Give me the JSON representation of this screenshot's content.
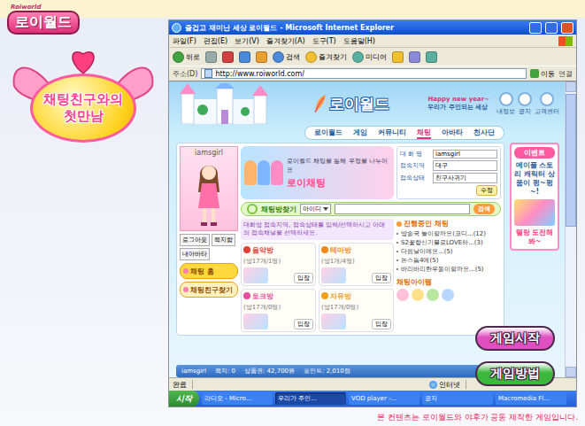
{
  "logo": {
    "small": "Roiworld",
    "title": "로이월드"
  },
  "badge": {
    "title": "채팅친구와의 첫만남"
  },
  "browser": {
    "title": "즐겁고 재미난 세상 로이월드 - Microsoft Internet Explorer",
    "menu": [
      "파일(F)",
      "편집(E)",
      "보기(V)",
      "즐겨찾기(A)",
      "도구(T)",
      "도움말(H)"
    ],
    "toolbar": [
      "뒤로",
      "검색",
      "즐겨찾기",
      "미디어"
    ],
    "address_label": "주소(D)",
    "address": "http://www.roiworld.com/",
    "go": "이동",
    "links": "연결",
    "status": "완료",
    "zone": "인터넷"
  },
  "site": {
    "logo": "로이월드",
    "greeting": "Happy new year~",
    "slogan": "우리가 주인되는 세상",
    "top_icons": [
      "내정보",
      "공지",
      "고객센터"
    ],
    "nav": [
      {
        "label": "로이월드",
        "selected": false
      },
      {
        "label": "게임",
        "selected": false
      },
      {
        "label": "커뮤니티",
        "selected": false
      },
      {
        "label": "채팅",
        "selected": true
      },
      {
        "label": "아바타",
        "selected": false
      },
      {
        "label": "천사단",
        "selected": false
      }
    ],
    "profile": {
      "name": "iamsgirl",
      "buttons": [
        "로그아웃",
        "쪽지함",
        "내아바타"
      ]
    },
    "side_menu": [
      {
        "label": "채팅 홈",
        "selected": true
      },
      {
        "label": "채팅친구찾기",
        "selected": false
      }
    ],
    "banner": {
      "text": "로이월드 채팅을 통해 우정을 나누어요",
      "title": "로이채팅"
    },
    "info": {
      "rows": [
        {
          "label": "대 화 명",
          "value": "iamsgirl"
        },
        {
          "label": "접속지역",
          "value": "대구"
        },
        {
          "label": "접속상태",
          "value": "친구사귀기"
        }
      ],
      "button": "수정"
    },
    "search": {
      "label": "채팅방찾기",
      "field": "아이디",
      "button": "검색"
    },
    "notice": "대화방 접속지역, 접속상태를 입력/선택하시고 아래의 접속채널을 선택하세요.",
    "channels": [
      {
        "name": "음악방",
        "count": "(방17개/1명)",
        "button": "입장",
        "color": "#e0403a"
      },
      {
        "name": "테마방",
        "count": "(방1개/4명)",
        "button": "입장",
        "color": "#ef8a1a"
      },
      {
        "name": "토크방",
        "count": "(방17개/0명)",
        "button": "입장",
        "color": "#e04fa0"
      },
      {
        "name": "자유방",
        "count": "(방17개/0명)",
        "button": "입장",
        "color": "#f0a020"
      }
    ],
    "live": {
      "title": "진행중인 채팅",
      "items": [
        "방송국 놀이할까요(코디...(12)",
        "S2꽃향신기블로LOVE하...(3)",
        "다음날이에요...(5)",
        "논스톱4에(5)",
        "바리바리한우동이할까요...(5)"
      ]
    },
    "items_title": "채팅아이템",
    "ad": {
      "title": "이벤트",
      "text": "메이플 스토리 캐릭터 상품이 펑~펑~!",
      "cta": "텔랑 도전해봐~"
    },
    "status": [
      "iamsgirl",
      "쪽지: 0",
      "상품권: 42,700원",
      "포인트: 2,010점"
    ]
  },
  "taskbar": {
    "start": "시작",
    "items": [
      {
        "label": "라디오 - Micro...",
        "selected": false
      },
      {
        "label": "우리가 주인...",
        "selected": true
      },
      {
        "label": "VOD player -...",
        "selected": false
      },
      {
        "label": "공지",
        "selected": false
      },
      {
        "label": "Macromedia Fl...",
        "selected": false
      }
    ]
  },
  "game_buttons": [
    {
      "label": "게임시작",
      "color": "#e04fc0"
    },
    {
      "label": "게임방법",
      "color": "#3cb83c"
    }
  ],
  "footer": "본 컨텐츠는 로이월드와 야후가 공동 제작한 게임입니다."
}
